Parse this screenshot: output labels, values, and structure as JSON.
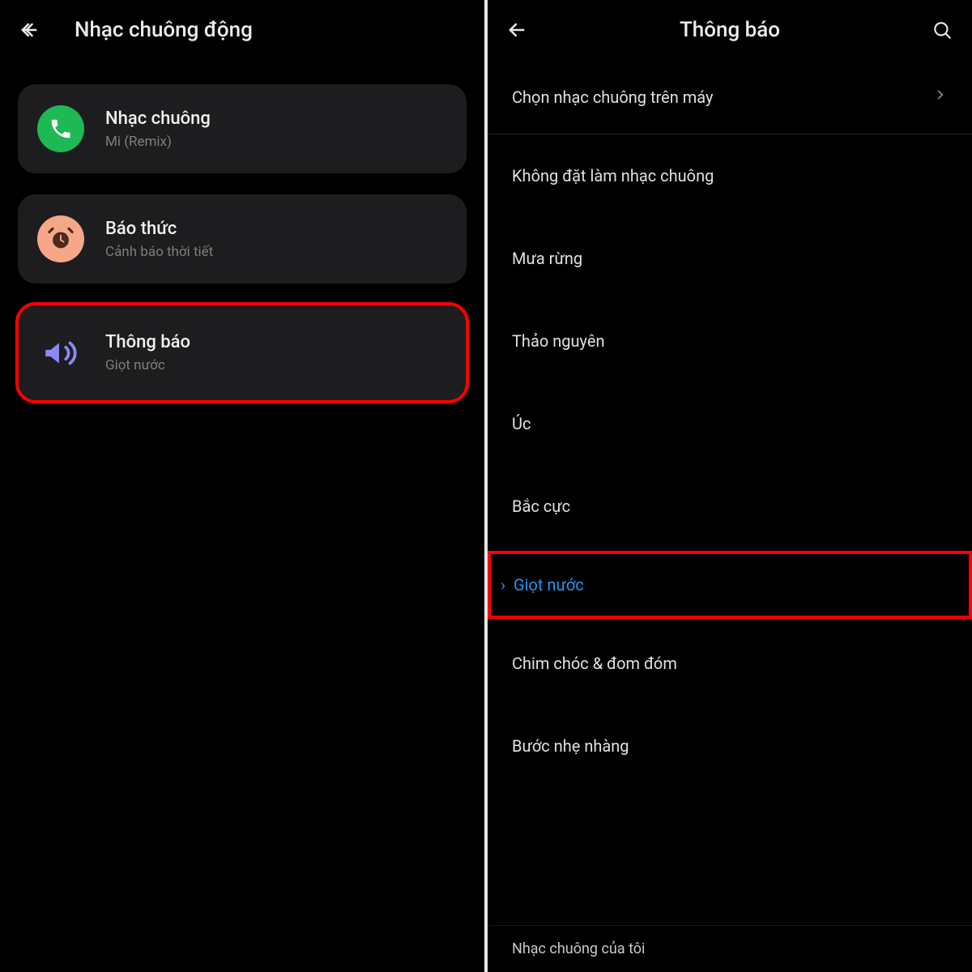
{
  "left": {
    "title": "Nhạc chuông động",
    "cards": [
      {
        "title": "Nhạc chuông",
        "sub": "Mi (Remix)"
      },
      {
        "title": "Báo thức",
        "sub": "Cảnh báo thời tiết"
      },
      {
        "title": "Thông báo",
        "sub": "Giọt nước"
      }
    ]
  },
  "right": {
    "title": "Thông báo",
    "pick_local": "Chọn nhạc chuông trên máy",
    "items": [
      "Không đặt làm nhạc chuông",
      "Mưa rừng",
      "Thảo nguyên",
      "Úc",
      "Bắc cực",
      "Giọt nước",
      "Chim chóc & đom đóm",
      "Bước nhẹ nhàng"
    ],
    "footer": "Nhạc chuông của tôi"
  }
}
